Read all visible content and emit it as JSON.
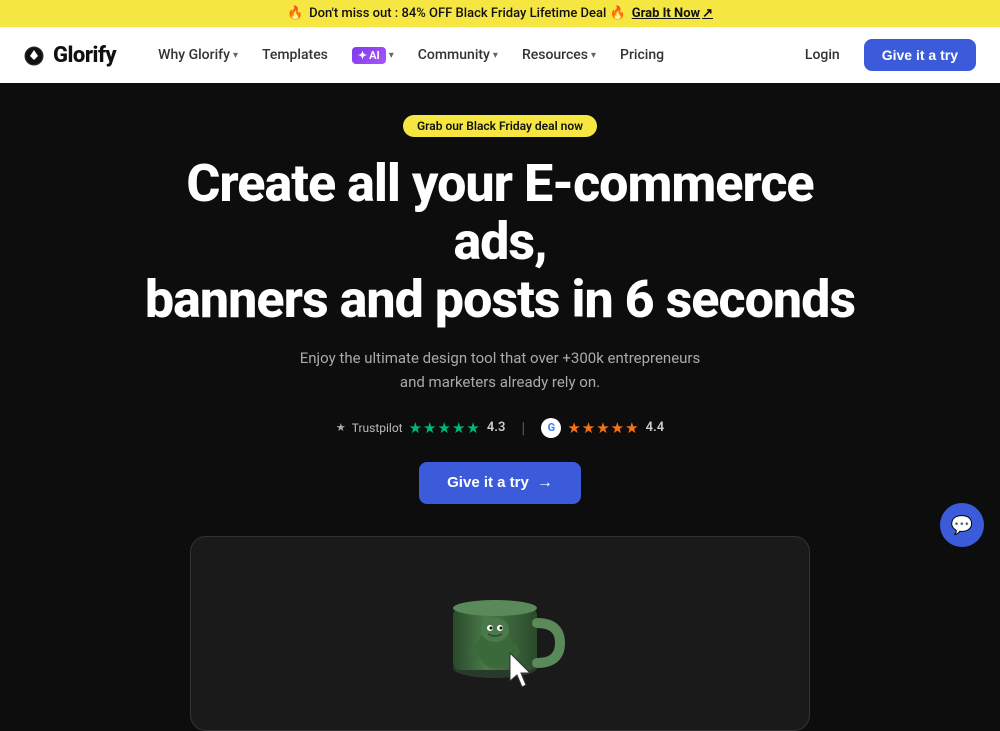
{
  "banner": {
    "text": "Don't miss out : 84% OFF Black Friday Lifetime Deal 🔥",
    "cta_label": "Grab It Now",
    "cta_arrow": "↗"
  },
  "navbar": {
    "logo": "Glorify",
    "links": [
      {
        "label": "Why Glorify",
        "has_dropdown": true
      },
      {
        "label": "Templates",
        "has_dropdown": false
      },
      {
        "label": "AI",
        "has_dropdown": true,
        "is_ai": true
      },
      {
        "label": "Community",
        "has_dropdown": true
      },
      {
        "label": "Resources",
        "has_dropdown": true
      },
      {
        "label": "Pricing",
        "has_dropdown": false
      }
    ],
    "login_label": "Login",
    "try_label": "Give it a try"
  },
  "hero": {
    "badge_text": "Grab our Black Friday deal now",
    "title_line1": "Create all your E-commerce ads,",
    "title_line2": "banners and posts in 6 seconds",
    "subtitle_line1": "Enjoy the ultimate design tool that over +300k entrepreneurs",
    "subtitle_line2": "and marketers already rely on.",
    "trustpilot_label": "Trustpilot",
    "tp_score": "4.3",
    "g_score": "4.4",
    "cta_label": "Give it a try",
    "cta_arrow": "→"
  },
  "chat": {
    "icon": "💬"
  }
}
